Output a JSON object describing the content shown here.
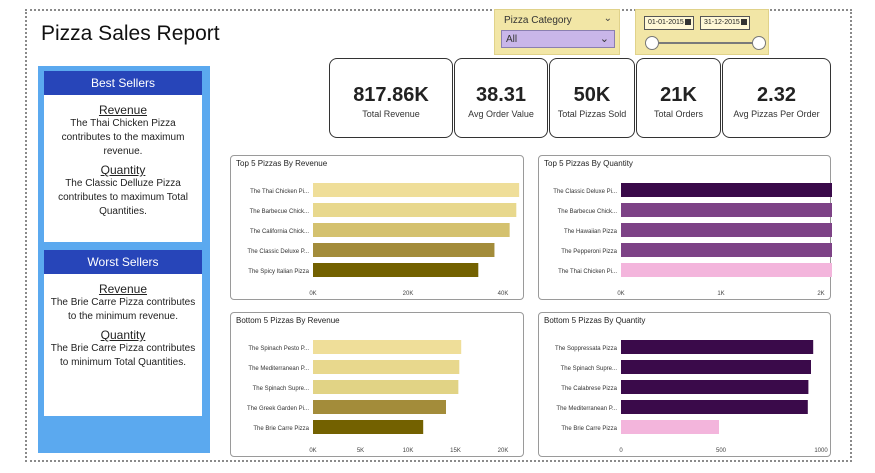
{
  "report": {
    "title": "Pizza Sales Report"
  },
  "filters": {
    "category_label": "Pizza Category",
    "category_value": "All",
    "date_start": "01-01-2015",
    "date_end": "31-12-2015"
  },
  "kpis": [
    {
      "value": "817.86K",
      "label": "Total Revenue"
    },
    {
      "value": "38.31",
      "label": "Avg Order Value"
    },
    {
      "value": "50K",
      "label": "Total Pizzas Sold"
    },
    {
      "value": "21K",
      "label": "Total Orders"
    },
    {
      "value": "2.32",
      "label": "Avg Pizzas Per Order"
    }
  ],
  "best": {
    "header": "Best Sellers",
    "revenue_title": "Revenue",
    "revenue_text": "The Thai Chicken Pizza contributes to the maximum revenue.",
    "quantity_title": "Quantity",
    "quantity_text": "The Classic Delluze Pizza contributes to maximum Total Quantities."
  },
  "worst": {
    "header": "Worst Sellers",
    "revenue_title": "Revenue",
    "revenue_text": "The Brie Carre Pizza contributes to the minimum revenue.",
    "quantity_title": "Quantity",
    "quantity_text": "The Brie Carre Pizza contributes to minimum Total Quantities."
  },
  "chart_data": [
    {
      "type": "bar",
      "title": "Top 5 Pizzas By Revenue",
      "categories": [
        "The Thai Chicken Pi...",
        "The Barbecue Chick...",
        "The California Chick...",
        "The Classic Deluxe P...",
        "The Spicy Italian Pizza"
      ],
      "values": [
        43.4,
        42.8,
        41.4,
        38.2,
        34.8
      ],
      "xticks": [
        "0K",
        "20K",
        "40K"
      ],
      "tick_values": [
        0,
        20,
        40
      ],
      "xlim": [
        0,
        40
      ],
      "colors": [
        "#efde99",
        "#e8d88d",
        "#d4c16e",
        "#a38c3a",
        "#736100"
      ]
    },
    {
      "type": "bar",
      "title": "Top 5 Pizzas By Quantity",
      "categories": [
        "The Classic Deluxe Pi...",
        "The Barbecue Chick...",
        "The Hawaiian Pizza",
        "The Pepperoni Pizza",
        "The Thai Chicken Pi..."
      ],
      "values": [
        2.45,
        2.43,
        2.42,
        2.42,
        2.37
      ],
      "xticks": [
        "0K",
        "1K",
        "2K"
      ],
      "tick_values": [
        0,
        1,
        2
      ],
      "xlim": [
        0,
        2
      ],
      "colors": [
        "#3a0a4a",
        "#7d4286",
        "#7d4286",
        "#7d4286",
        "#f3b5dc"
      ]
    },
    {
      "type": "bar",
      "title": "Bottom 5 Pizzas By Revenue",
      "categories": [
        "The Spinach Pesto P...",
        "The Mediterranean P...",
        "The Spinach Supre...",
        "The Greek Garden Pi...",
        "The Brie Carre Pizza"
      ],
      "values": [
        15.6,
        15.4,
        15.3,
        14.0,
        11.6
      ],
      "xticks": [
        "0K",
        "5K",
        "10K",
        "15K",
        "20K"
      ],
      "tick_values": [
        0,
        5,
        10,
        15,
        20
      ],
      "xlim": [
        0,
        20
      ],
      "colors": [
        "#efde99",
        "#e8d88d",
        "#e1d385",
        "#a38c3a",
        "#736100"
      ]
    },
    {
      "type": "bar",
      "title": "Bottom 5 Pizzas By Quantity",
      "categories": [
        "The Soppressata Pizza",
        "The Spinach Supre...",
        "The Calabrese Pizza",
        "The Mediterranean P...",
        "The Brie Carre Pizza"
      ],
      "values": [
        961,
        950,
        937,
        934,
        490
      ],
      "xticks": [
        "0",
        "500",
        "1000"
      ],
      "tick_values": [
        0,
        500,
        1000
      ],
      "xlim": [
        0,
        1000
      ],
      "colors": [
        "#3a0a4a",
        "#3a0a4a",
        "#3a0a4a",
        "#3a0a4a",
        "#f3b5dc"
      ]
    }
  ]
}
